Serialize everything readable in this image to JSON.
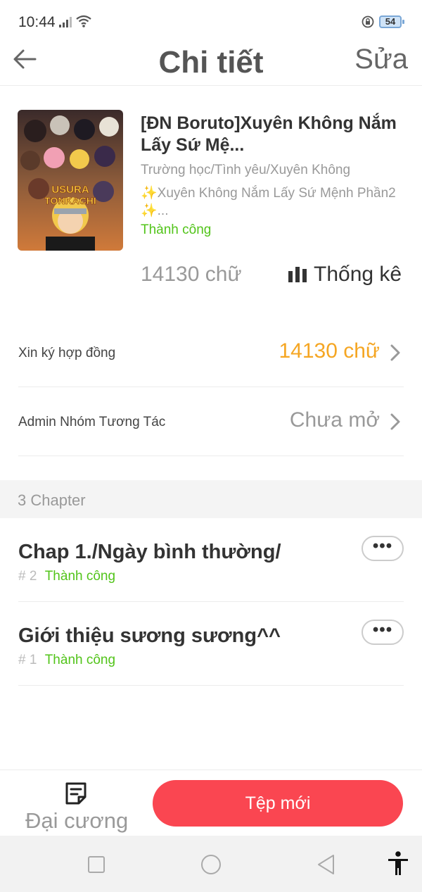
{
  "status_bar": {
    "time": "10:44",
    "battery": "54",
    "icons": [
      "signal-icon",
      "wifi-icon",
      "rotation-lock-icon",
      "battery-icon"
    ]
  },
  "header": {
    "back_icon": "arrow-left-icon",
    "title": "Chi tiết",
    "edit_label": "Sửa"
  },
  "book": {
    "title": "[ĐN Boruto]Xuyên Không Nắm Lấy Sứ Mệ...",
    "genres": "Trường học/Tình yêu/Xuyên Không",
    "description": "✨Xuyên Không Nắm Lấy Sứ Mệnh Phần2 ✨...",
    "status": "Thành công",
    "word_count": "14130 chữ",
    "stats_label": "Thống kê",
    "cover_text": "USURA TONKACHI",
    "status_color": "#52c41a"
  },
  "settings": [
    {
      "label": "Xin ký hợp đồng",
      "value": "14130 chữ",
      "value_color": "#f5a623"
    },
    {
      "label": "Admin Nhóm Tương Tác",
      "value": "Chưa mở",
      "value_color": "#999999"
    }
  ],
  "chapters_header": "3 Chapter",
  "chapters": [
    {
      "title": "Chap 1./Ngày bình thường/",
      "number": "# 2",
      "status": "Thành công",
      "more": "•••"
    },
    {
      "title": "Giới thiệu sương sương^^",
      "number": "# 1",
      "status": "Thành công",
      "more": "•••"
    }
  ],
  "bottom_bar": {
    "outline_label": "Đại cương",
    "outline_icon": "document-note-icon",
    "new_file_label": "Tệp mới",
    "accent_color": "#fa4651"
  },
  "nav_bar": {
    "icons": [
      "recents-square-icon",
      "home-circle-icon",
      "back-triangle-icon",
      "accessibility-icon"
    ]
  }
}
